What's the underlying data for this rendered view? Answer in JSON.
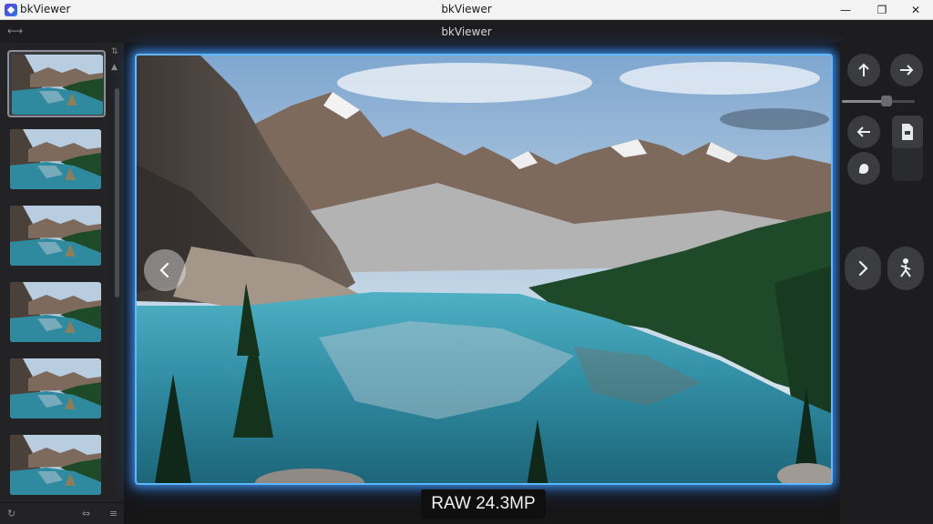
{
  "window": {
    "app_name": "bkViewer",
    "title": "bkViewer",
    "minimize_glyph": "—",
    "maximize_glyph": "❐",
    "close_glyph": "✕"
  },
  "header": {
    "title": "bkViewer",
    "expand_glyph": "⟷"
  },
  "sidebar": {
    "thumbnails": [
      {
        "selected": true,
        "number": "",
        "meta": ""
      },
      {
        "selected": false,
        "number": "",
        "meta": ""
      },
      {
        "selected": false,
        "number": "",
        "meta": ""
      },
      {
        "selected": false,
        "number": "",
        "meta": ""
      },
      {
        "selected": false,
        "number": "",
        "meta": ""
      },
      {
        "selected": false,
        "number": "",
        "meta": ""
      }
    ],
    "bottom_icons": [
      "refresh-icon",
      "swap-icon",
      "menu-icon"
    ]
  },
  "viewer": {
    "format_badge": "RAW 24.3MP",
    "colors": {
      "frame_glow": "#5fb8ff",
      "sky_top": "#7fa7cf",
      "lake": "#2f8aa0",
      "forest": "#1f4a2a"
    }
  },
  "tools": {
    "icons": [
      "arrow-up-icon",
      "arrow-right-icon",
      "arrow-left-icon",
      "document-icon",
      "hand-icon",
      "chevron-right-icon",
      "figure-icon"
    ]
  }
}
